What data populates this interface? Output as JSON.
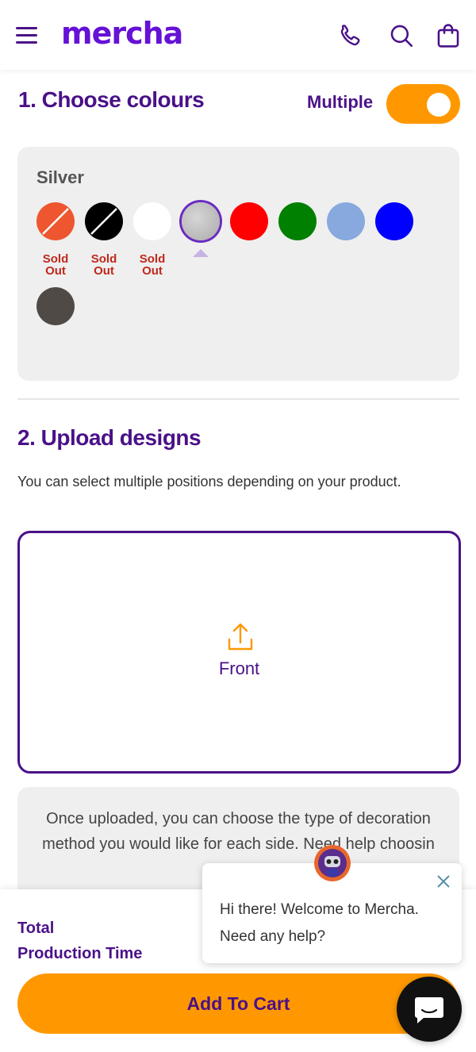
{
  "header": {
    "logo": "mercha",
    "menu_icon": "hamburger-icon",
    "phone_icon": "phone-icon",
    "search_icon": "search-icon",
    "cart_icon": "shopping-bag-icon"
  },
  "colours_section": {
    "title": "1. Choose colours",
    "multiple_label": "Multiple",
    "multiple_enabled": true,
    "selected_colour": "Silver",
    "swatches": [
      {
        "color": "#ee5630",
        "sold_out": true,
        "sold_out_label": "Sold Out"
      },
      {
        "color": "#000000",
        "sold_out": true,
        "sold_out_label": "Sold Out"
      },
      {
        "color": "#ffffff",
        "sold_out": true,
        "sold_out_label": "Sold Out"
      },
      {
        "color": "#c0c0c0",
        "sold_out": false,
        "selected": true
      },
      {
        "color": "#ff0000",
        "sold_out": false
      },
      {
        "color": "#008000",
        "sold_out": false
      },
      {
        "color": "#87a9de",
        "sold_out": false
      },
      {
        "color": "#0000ff",
        "sold_out": false
      },
      {
        "color": "#4f4a45",
        "sold_out": false
      }
    ]
  },
  "upload_section": {
    "title": "2. Upload designs",
    "description": "You can select multiple positions depending on your product.",
    "upload_box_label": "Front",
    "upload_icon": "upload-icon",
    "info_text": "Once uploaded, you can choose the type of decoration method you would like for each side. Need help choosin"
  },
  "bottom_bar": {
    "total_label": "Total",
    "production_time_label": "Production Time",
    "add_to_cart_label": "Add To Cart"
  },
  "chat": {
    "message_line1": "Hi there! Welcome to Mercha.",
    "message_line2": "Need any help?",
    "close_icon": "close-icon",
    "avatar_icon": "robot-avatar-icon",
    "launcher_icon": "chat-bubble-icon"
  },
  "colors": {
    "brand_purple": "#4a1188",
    "logo_purple": "#6511d6",
    "accent_orange": "#ff9800",
    "sold_out_red": "#c0281c"
  }
}
